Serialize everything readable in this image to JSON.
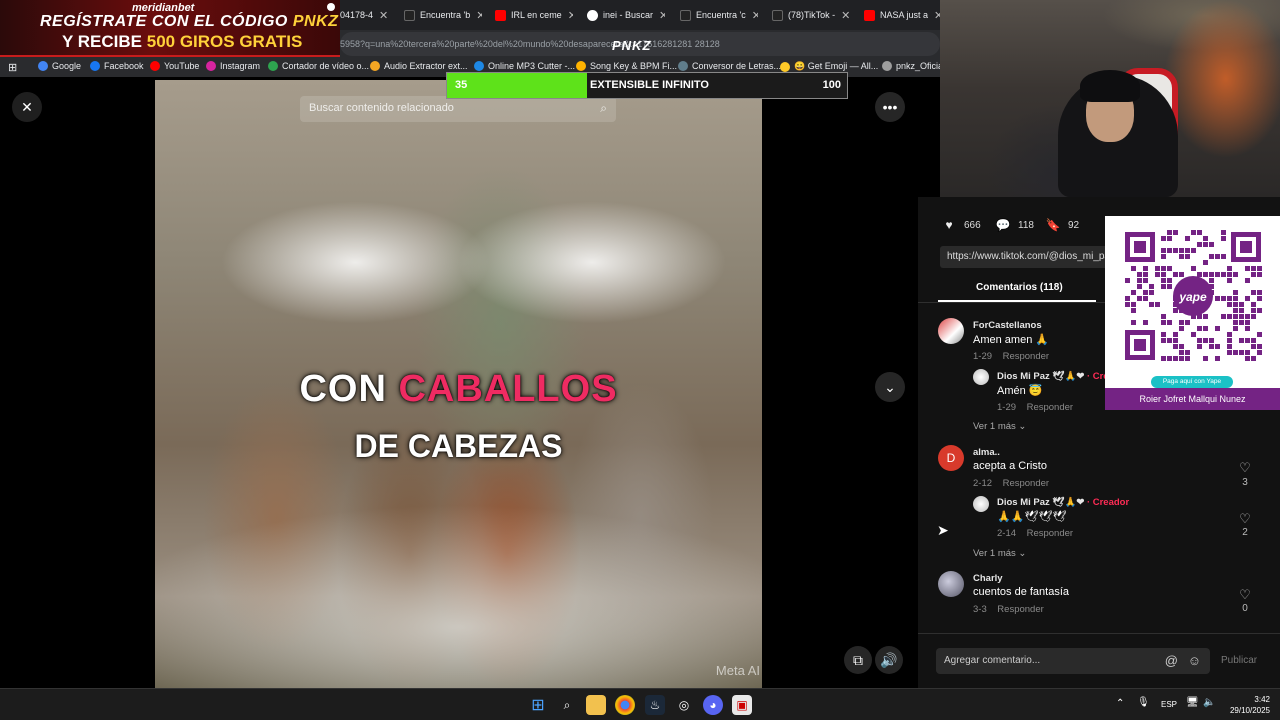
{
  "ad": {
    "brand": "meridianbet",
    "line1_pre": "REGÍSTRATE CON EL CÓDIGO",
    "line1_code": "PNKZ",
    "line2_pre": "Y RECIBE",
    "line2_highlight": "500 GIROS GRATIS"
  },
  "overlay_logo": "PNKZ",
  "browser": {
    "tabs": [
      {
        "label": "04178-4",
        "color": "#3b6fd6"
      },
      {
        "label": "Encuentra 'b",
        "color": "#222"
      },
      {
        "label": "IRL en ceme",
        "color": "#ff0000"
      },
      {
        "label": "inei - Buscar",
        "color": "#4285f4"
      },
      {
        "label": "Encuentra 'c",
        "color": "#222"
      },
      {
        "label": "(78)TikTok -",
        "color": "#222"
      },
      {
        "label": "NASA just a",
        "color": "#ff0000"
      }
    ],
    "address": "5958?q=una%20tercera%20parte%20del%20mundo%20desaparecera&t=17616281281 28128",
    "bookmarks": [
      {
        "label": "Google",
        "color": "#4285f4"
      },
      {
        "label": "Facebook",
        "color": "#1877f2"
      },
      {
        "label": "YouTube",
        "color": "#ff0000"
      },
      {
        "label": "Instagram",
        "color": "#d6249f"
      },
      {
        "label": "Cortador de vídeo o...",
        "color": "#2ea44f"
      },
      {
        "label": "Audio Extractor ext...",
        "color": "#f5a623"
      },
      {
        "label": "Online MP3 Cutter -...",
        "color": "#1e88e5"
      },
      {
        "label": "Song Key & BPM Fi...",
        "color": "#ffb300"
      },
      {
        "label": "Conversor de Letras...",
        "color": "#607d8b"
      },
      {
        "label": "😀 Get Emoji — All...",
        "color": "#ffca28"
      },
      {
        "label": "pnkz_Oficial",
        "color": "#9e9e9e"
      }
    ]
  },
  "subathon": {
    "left_value": "35",
    "title": "EXTENSIBLE INFINITO",
    "right_value": "100",
    "progress": 0.35,
    "fill_color": "#5ee21a"
  },
  "video": {
    "search_placeholder": "Buscar contenido relacionado",
    "caption_word1": "CON",
    "caption_word2": "CABALLOS",
    "caption_line2": "DE CABEZAS",
    "watermark": "Meta AI",
    "accent": "#ef2b62"
  },
  "stats": {
    "likes": "666",
    "comments": "118",
    "saves": "92"
  },
  "share_url": "https://www.tiktok.com/@dios_mi_paz",
  "comments_tab": "Comentarios (118)",
  "comments": [
    {
      "user": "ForCastellanos",
      "text": "Amen amen 🙏",
      "date": "1-29",
      "reply": "Responder"
    },
    {
      "user": "Dios Mi Paz",
      "badges": "🕊🙏❤",
      "creator": "· Creador",
      "text": "Amén 😇",
      "date": "1-29",
      "reply": "Responder"
    },
    {
      "more": "Ver 1 más"
    },
    {
      "user": "alma..",
      "avatar_letter": "D",
      "text": "acepta a Cristo",
      "date": "2-12",
      "reply": "Responder",
      "likes": "3"
    },
    {
      "user": "Dios Mi Paz",
      "badges": "🕊🙏❤",
      "creator": "· Creador",
      "text": "🙏🙏🕊🕊🕊",
      "date": "2-14",
      "reply": "Responder",
      "likes": "2"
    },
    {
      "more": "Ver 1 más"
    },
    {
      "user": "Charly",
      "text": "cuentos de fantasía",
      "date": "3-3",
      "reply": "Responder",
      "likes": "0"
    }
  ],
  "composer": {
    "placeholder": "Agregar comentario...",
    "post": "Publicar"
  },
  "qr": {
    "pill": "Paga aquí con Yape",
    "name": "Roier Jofret Mallqui Nunez",
    "brand_color": "#742384"
  },
  "taskbar": {
    "lang": "ESP",
    "time": "3:42",
    "date": "29/10/2025"
  }
}
